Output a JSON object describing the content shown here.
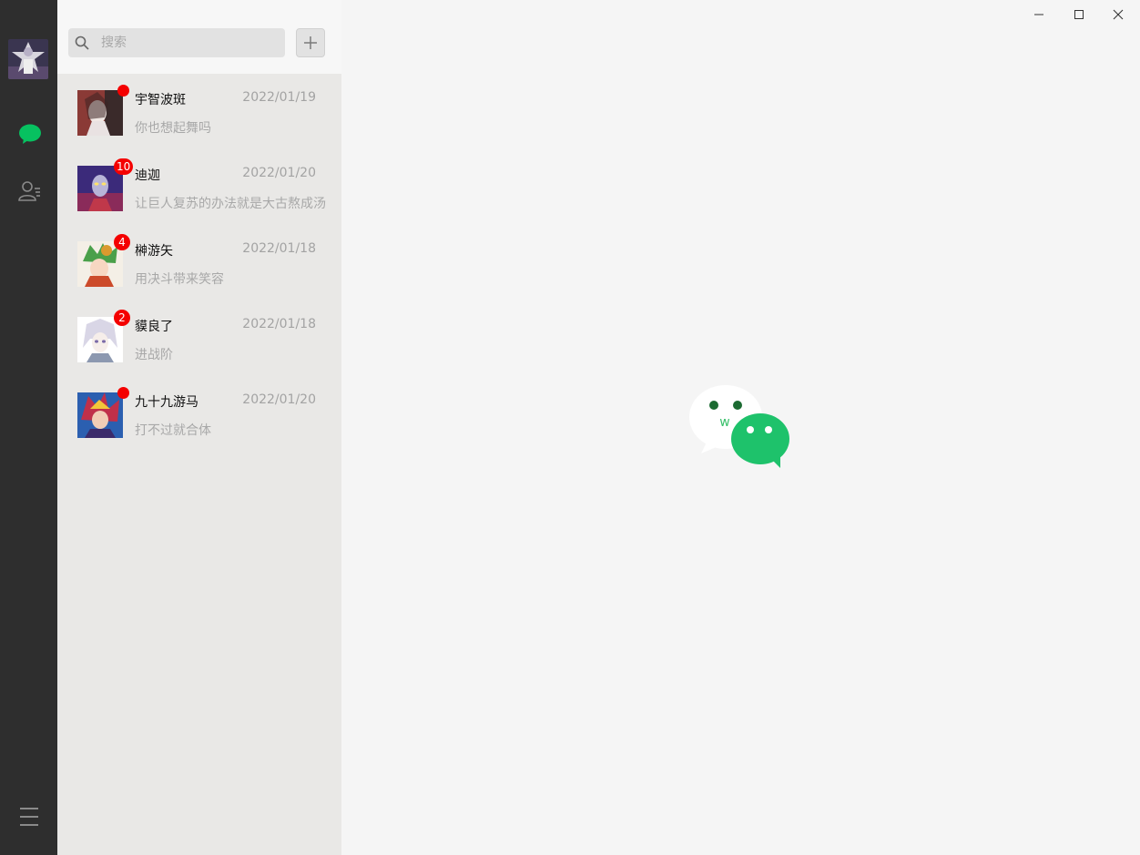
{
  "sidebar": {
    "profile_avatar": "profile-avatar",
    "nav": [
      {
        "name": "chat-icon",
        "active": true,
        "color": "#07c160"
      },
      {
        "name": "contacts-icon",
        "active": false,
        "color": "#8a8a8a"
      },
      {
        "name": "menu-icon",
        "active": false,
        "color": "#8a8a8a"
      }
    ]
  },
  "search": {
    "placeholder": "搜索",
    "value": ""
  },
  "add_button": {
    "icon": "plus-icon"
  },
  "conversations": [
    {
      "name": "宇智波斑",
      "time": "2022/01/19",
      "preview": "你也想起舞吗",
      "badge": ""
    },
    {
      "name": "迪迦",
      "time": "2022/01/20",
      "preview": "让巨人复苏的办法就是大古熬成汤",
      "badge": "10"
    },
    {
      "name": "榊游矢",
      "time": "2022/01/18",
      "preview": "用决斗带来笑容",
      "badge": "4"
    },
    {
      "name": "貘良了",
      "time": "2022/01/18",
      "preview": "进战阶",
      "badge": "2"
    },
    {
      "name": "九十九游马",
      "time": "2022/01/20",
      "preview": "打不过就合体",
      "badge": ""
    }
  ],
  "colors": {
    "brand": "#07c160",
    "badge": "#f40000",
    "sidebar_bg": "#2e2e2e",
    "list_bg": "#e9e8e6"
  },
  "window_controls": [
    "minimize-icon",
    "maximize-icon",
    "close-icon"
  ],
  "logo": {
    "letter": "w"
  }
}
